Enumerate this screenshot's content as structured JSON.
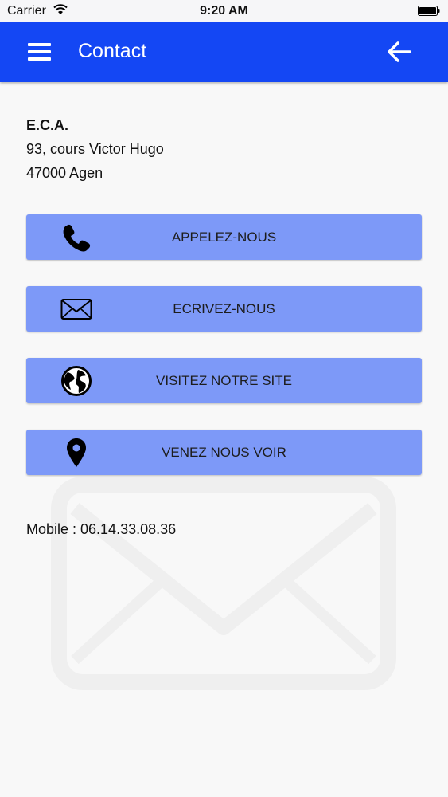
{
  "status_bar": {
    "carrier": "Carrier",
    "time": "9:20 AM"
  },
  "header": {
    "title": "Contact"
  },
  "company": {
    "name": "E.C.A.",
    "address_line1": "93, cours Victor Hugo",
    "address_line2": "47000 Agen"
  },
  "buttons": [
    {
      "label": "APPELEZ-NOUS",
      "icon": "phone-icon"
    },
    {
      "label": "ECRIVEZ-NOUS",
      "icon": "envelope-icon"
    },
    {
      "label": "VISITEZ NOTRE SITE",
      "icon": "globe-icon"
    },
    {
      "label": "VENEZ NOUS VOIR",
      "icon": "map-pin-icon"
    }
  ],
  "mobile": "Mobile : 06.14.33.08.36",
  "colors": {
    "app_bar": "#1447f4",
    "button_bg": "#7d99f8",
    "page_bg": "#f8f8f8"
  }
}
